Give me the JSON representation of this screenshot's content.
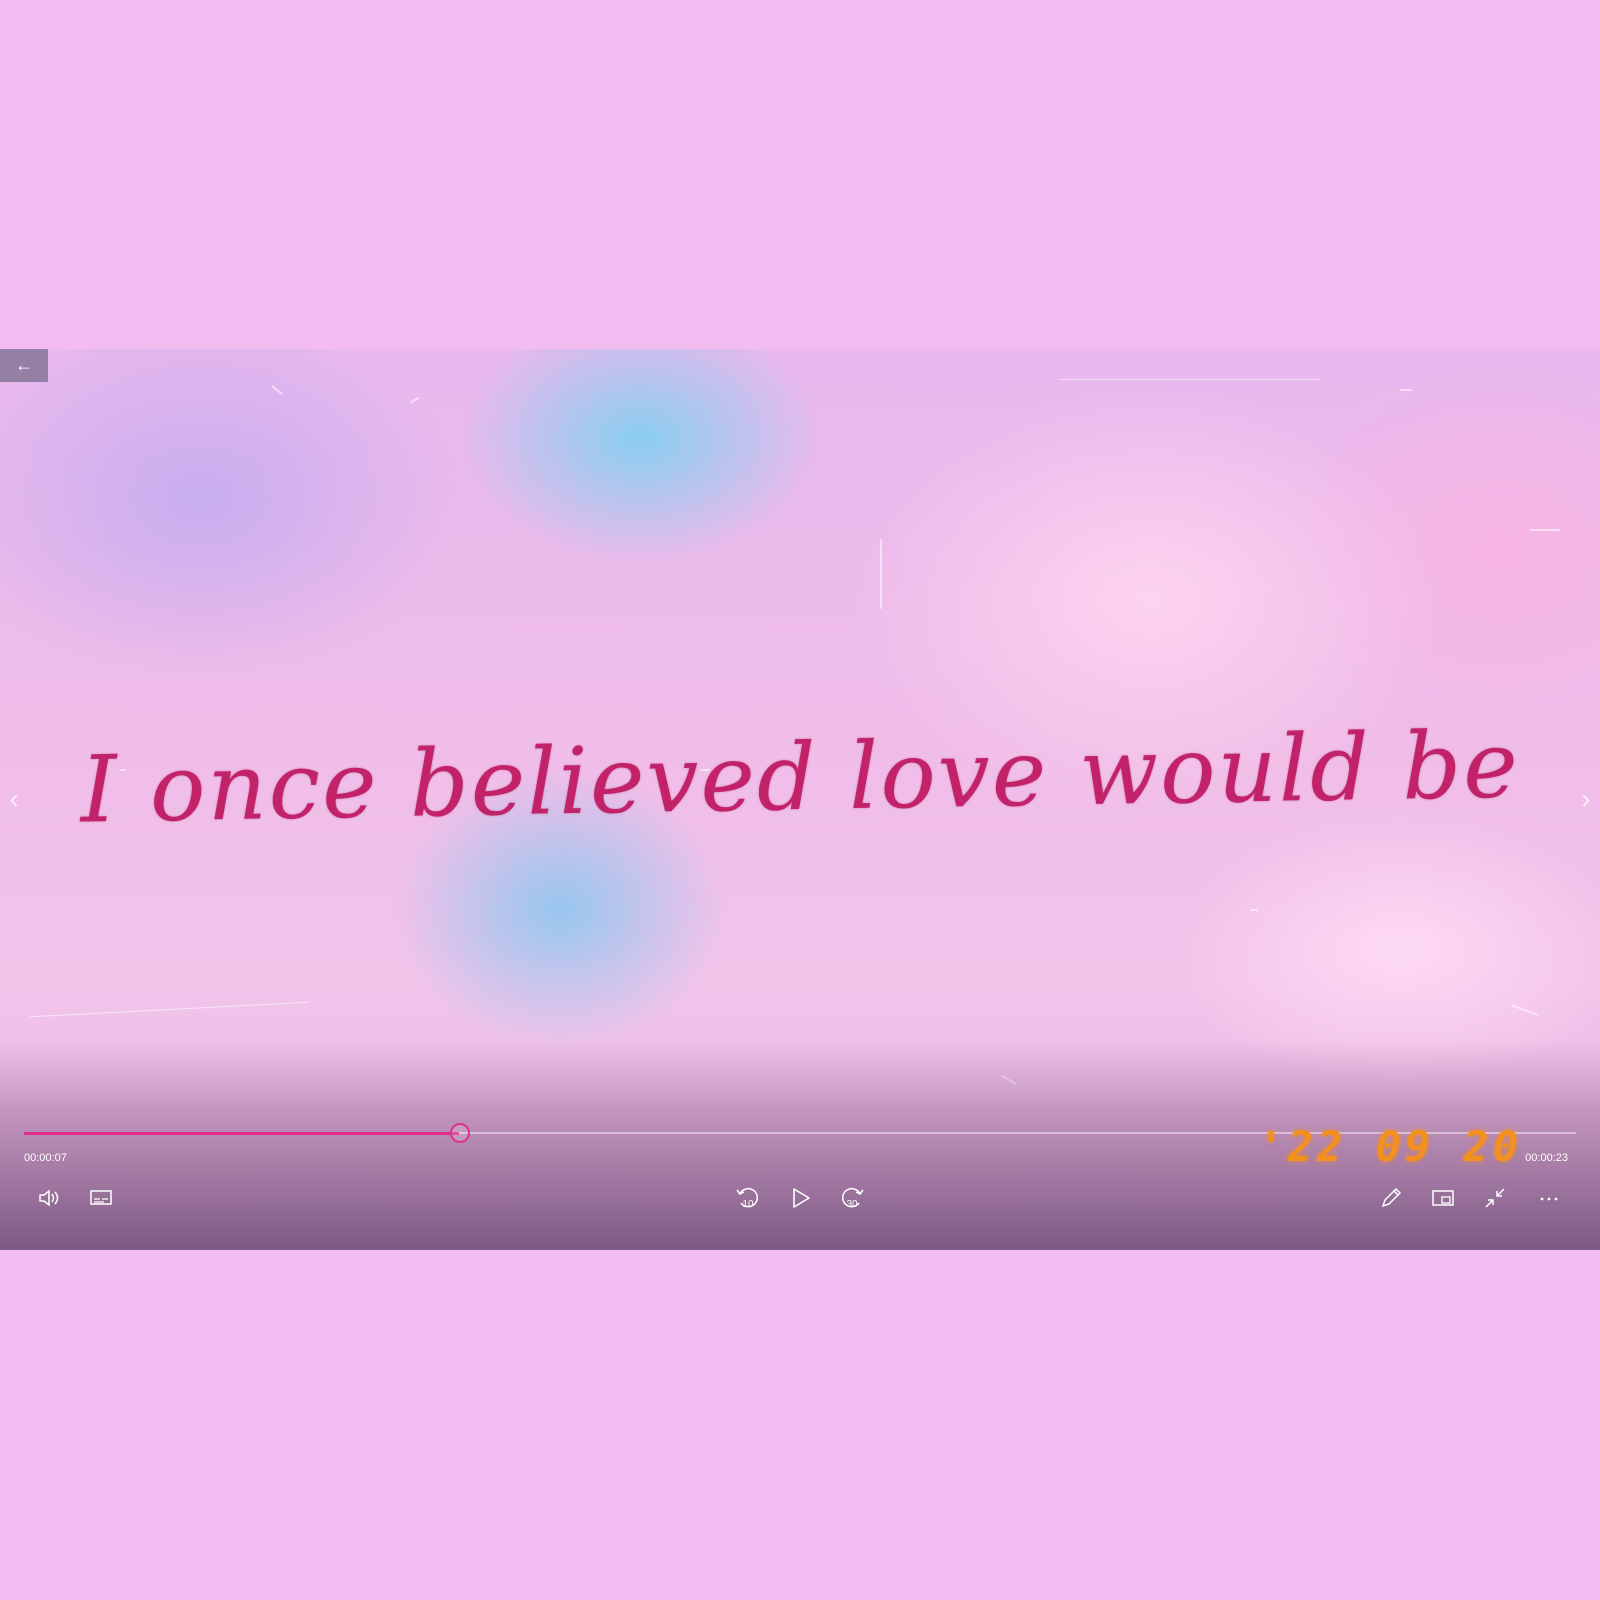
{
  "lyric": "I once believed love would be",
  "player": {
    "time_elapsed": "00:00:07",
    "time_total": "00:00:23",
    "progress": 0.28,
    "datestamp": "'22 09 20",
    "skip_back_seconds": "10",
    "skip_forward_seconds": "30"
  },
  "icons": {
    "back": "arrow-left-icon",
    "volume": "speaker-icon",
    "captions": "captions-icon",
    "rewind": "skip-back-10-icon",
    "play": "play-icon",
    "forward": "skip-forward-30-icon",
    "edit": "pencil-icon",
    "mini_view": "mini-view-icon",
    "exit_fullscreen": "shrink-icon",
    "more": "more-icon"
  },
  "colors": {
    "background": "#f2bcf0",
    "accent": "#e0308c",
    "lyric": "#c2226a",
    "datestamp": "#f3901e"
  }
}
